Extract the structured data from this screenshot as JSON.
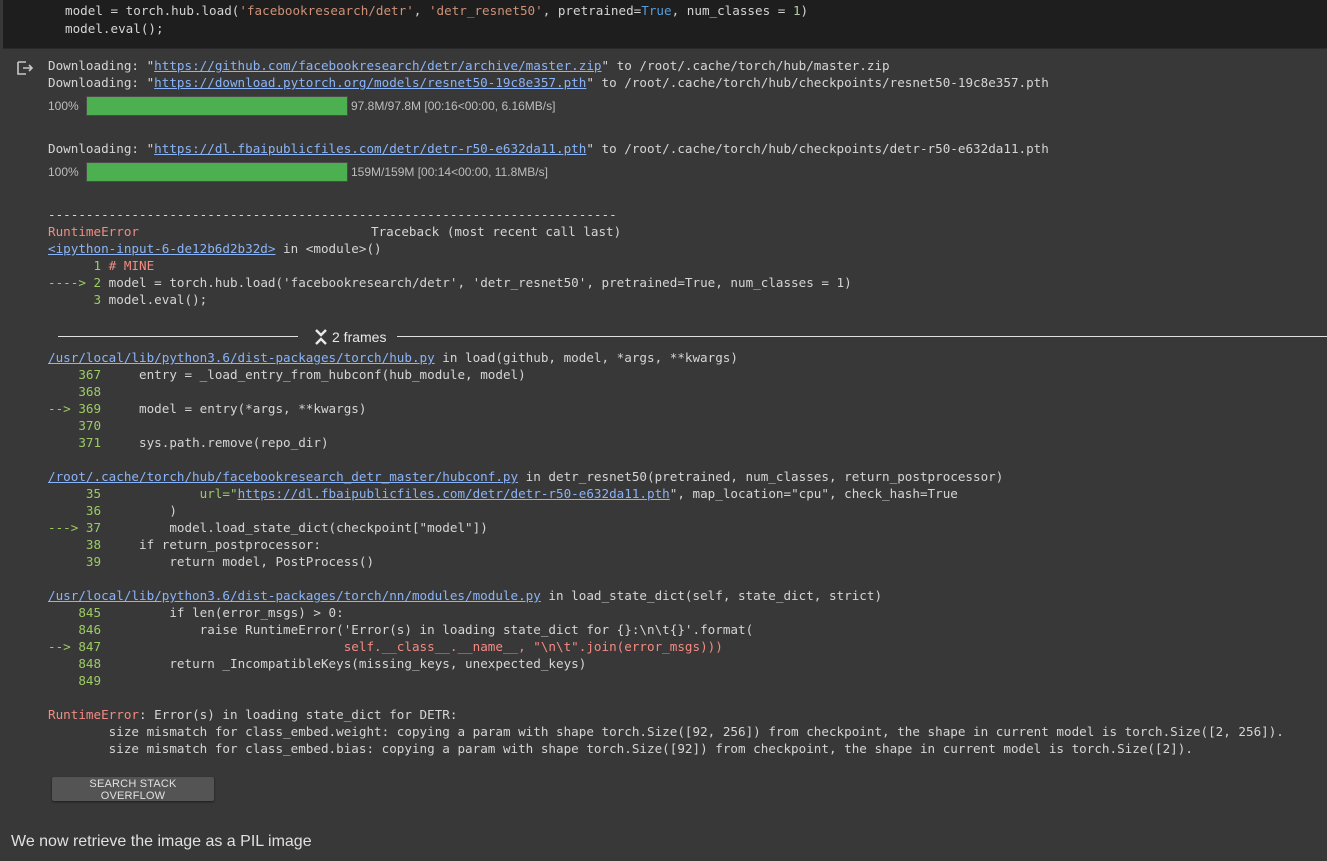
{
  "code_cell": {
    "line1_parts": [
      "model = torch.hub.load(",
      "'facebookresearch/detr'",
      ", ",
      "'detr_resnet50'",
      ", pretrained=",
      "True",
      ", num_classes = ",
      "1",
      ")"
    ],
    "line2_parts": [
      "model.eval();"
    ]
  },
  "output": {
    "dl1_prefix": "Downloading: \"",
    "dl1_url": "https://github.com/facebookresearch/detr/archive/master.zip",
    "dl1_suffix": "\" to /root/.cache/torch/hub/master.zip",
    "dl2_prefix": "Downloading: \"",
    "dl2_url": "https://download.pytorch.org/models/resnet50-19c8e357.pth",
    "dl2_suffix": "\" to /root/.cache/torch/hub/checkpoints/resnet50-19c8e357.pth",
    "progress1": {
      "percent": "100%",
      "value": 1.0,
      "info": "97.8M/97.8M [00:16<00:00, 6.16MB/s]"
    },
    "dl3_prefix": "Downloading: \"",
    "dl3_url": "https://dl.fbaipublicfiles.com/detr/detr-r50-e632da11.pth",
    "dl3_suffix": "\" to /root/.cache/torch/hub/checkpoints/detr-r50-e632da11.pth",
    "progress2": {
      "percent": "100%",
      "value": 1.0,
      "info": "159M/159M [00:14<00:00, 11.8MB/s]"
    }
  },
  "traceback": {
    "dashes": "---------------------------------------------------------------------------",
    "error_name": "RuntimeError",
    "header_right": "Traceback (most recent call last)",
    "input_link": "<ipython-input-6-de12b6d2b32d>",
    "input_suffix": " in <module>()",
    "frame0": [
      {
        "prefix": "      1 ",
        "code": "# MINE"
      },
      {
        "prefix": "----> 2 ",
        "code": "model = torch.hub.load('facebookresearch/detr', 'detr_resnet50', pretrained=True, num_classes = 1)"
      },
      {
        "prefix": "      3 ",
        "code": "model.eval();"
      }
    ],
    "frames_label": "2 frames",
    "frame1_path": "/usr/local/lib/python3.6/dist-packages/torch/hub.py",
    "frame1_sig": " in load(github, model, *args, **kwargs)",
    "frame1": [
      {
        "prefix": "    367 ",
        "code": "    entry = _load_entry_from_hubconf(hub_module, model)"
      },
      {
        "prefix": "    368 ",
        "code": ""
      },
      {
        "prefix": "--> 369 ",
        "code": "    model = entry(*args, **kwargs)"
      },
      {
        "prefix": "    370 ",
        "code": ""
      },
      {
        "prefix": "    371 ",
        "code": "    sys.path.remove(repo_dir)"
      }
    ],
    "frame2_path": "/root/.cache/torch/hub/facebookresearch_detr_master/hubconf.py",
    "frame2_sig": " in detr_resnet50(pretrained, num_classes, return_postprocessor)",
    "frame2_l35_a": "     35             url=\"",
    "frame2_l35_url": "https://dl.fbaipublicfiles.com/detr/detr-r50-e632da11.pth",
    "frame2_l35_b": "\", map_location=\"cpu\", check_hash=True",
    "frame2": [
      {
        "prefix": "     36 ",
        "code": "        )"
      },
      {
        "prefix": "---> 37 ",
        "code": "        model.load_state_dict(checkpoint[\"model\"])"
      },
      {
        "prefix": "     38 ",
        "code": "    if return_postprocessor:"
      },
      {
        "prefix": "     39 ",
        "code": "        return model, PostProcess()"
      }
    ],
    "frame3_path": "/usr/local/lib/python3.6/dist-packages/torch/nn/modules/module.py",
    "frame3_sig": " in load_state_dict(self, state_dict, strict)",
    "frame3": [
      {
        "prefix": "    845 ",
        "code": "        if len(error_msgs) > 0:"
      },
      {
        "prefix": "    846 ",
        "code": "            raise RuntimeError('Error(s) in loading state_dict for {}:\\n\\t{}'.format("
      },
      {
        "prefix": "--> 847 ",
        "code": "                               self.__class__.__name__, \"\\n\\t\".join(error_msgs)))"
      },
      {
        "prefix": "    848 ",
        "code": "        return _IncompatibleKeys(missing_keys, unexpected_keys)"
      },
      {
        "prefix": "    849 ",
        "code": ""
      }
    ],
    "final_error_name": "RuntimeError",
    "final_error_msg": ": Error(s) in loading state_dict for DETR:",
    "final_lines": [
      "\tsize mismatch for class_embed.weight: copying a param with shape torch.Size([92, 256]) from checkpoint, the shape in current model is torch.Size([2, 256]).",
      "\tsize mismatch for class_embed.bias: copying a param with shape torch.Size([92]) from checkpoint, the shape in current model is torch.Size([2])."
    ]
  },
  "search_button_label": "SEARCH STACK OVERFLOW",
  "text_cell": "We now retrieve the image as a PIL image",
  "colors": {
    "progress_fill": "#4caf50",
    "link": "#8ab4f8",
    "error": "#f28b82"
  }
}
